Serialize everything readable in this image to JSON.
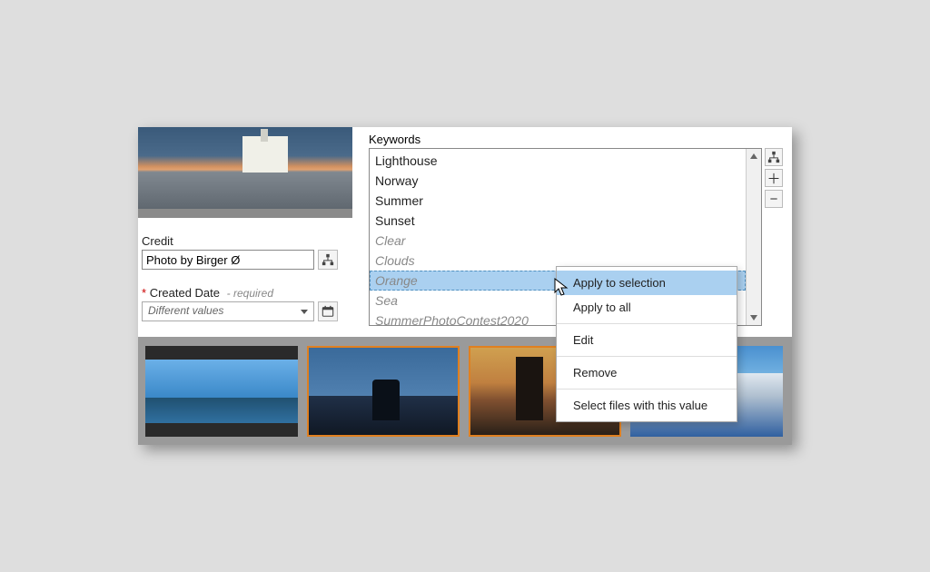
{
  "credit": {
    "label": "Credit",
    "value": "Photo by Birger Ø"
  },
  "createdDate": {
    "label": "Created Date",
    "hint": "- required",
    "value": "Different values"
  },
  "keywords": {
    "label": "Keywords",
    "items": [
      {
        "text": "Lighthouse",
        "partial": false,
        "selected": false
      },
      {
        "text": "Norway",
        "partial": false,
        "selected": false
      },
      {
        "text": "Summer",
        "partial": false,
        "selected": false
      },
      {
        "text": "Sunset",
        "partial": false,
        "selected": false
      },
      {
        "text": "Clear",
        "partial": true,
        "selected": false
      },
      {
        "text": "Clouds",
        "partial": true,
        "selected": false
      },
      {
        "text": "Orange",
        "partial": true,
        "selected": true
      },
      {
        "text": "Sea",
        "partial": true,
        "selected": false
      },
      {
        "text": "SummerPhotoContest2020",
        "partial": true,
        "selected": false
      }
    ]
  },
  "contextMenu": {
    "items": [
      "Apply to selection",
      "Apply to all",
      "Edit",
      "Remove",
      "Select files with this value"
    ],
    "highlightedIndex": 0
  },
  "asterisk": "*"
}
